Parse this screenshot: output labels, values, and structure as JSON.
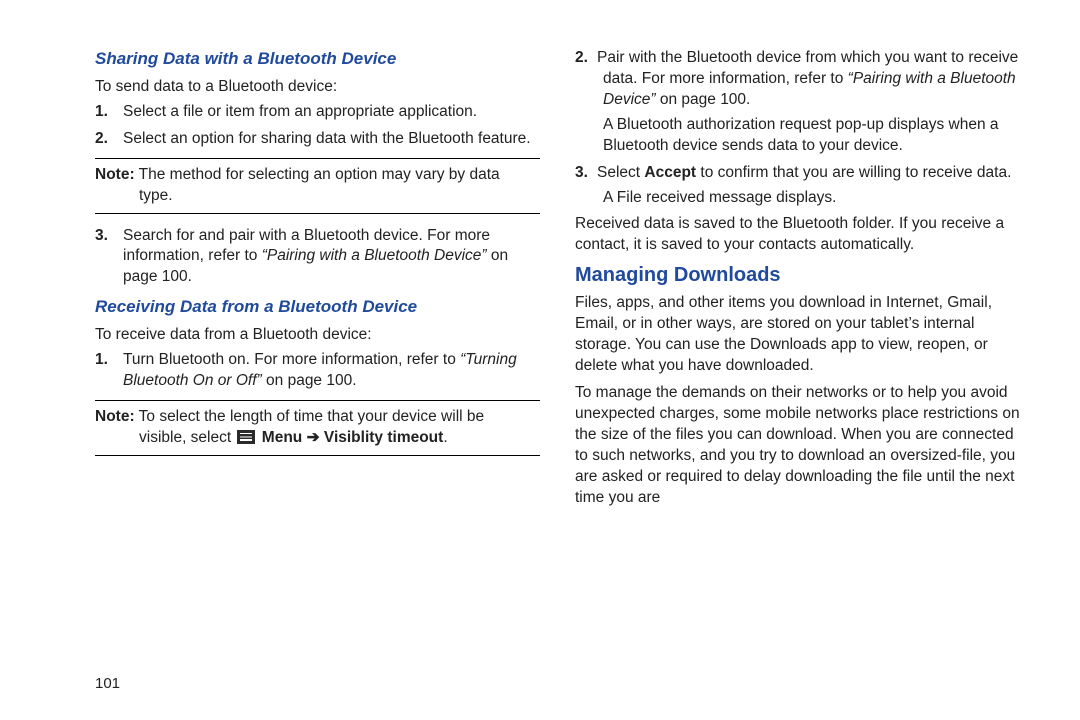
{
  "col1": {
    "h1": "Sharing Data with a Bluetooth Device",
    "intro1": "To send data to a Bluetooth device:",
    "li1_num": "1.",
    "li1": "Select a file or item from an appropriate application.",
    "li2_num": "2.",
    "li2": "Select an option for sharing data with the Bluetooth feature.",
    "note1_label": "Note:",
    "note1_lead": " The method for selecting an option may vary by data",
    "note1_cont": "type.",
    "li3_num": "3.",
    "li3a": "Search for and pair with a Bluetooth device. For more information, refer to ",
    "li3_ref": "“Pairing with a Bluetooth Device”",
    "li3b": " on page 100.",
    "h2": "Receiving Data from a Bluetooth Device",
    "intro2": "To receive data from a Bluetooth device:",
    "r_li1_num": "1.",
    "r_li1a": "Turn Bluetooth on. For more information, refer to ",
    "r_li1_ref": "“Turning Bluetooth On or Off”",
    "r_li1b": " on page 100.",
    "note2_label": "Note:",
    "note2_lead": " To select the length of time that your device will be",
    "note2_cont_a": "visible, select ",
    "note2_menu": " Menu ",
    "note2_arrow": "➔",
    "note2_vt": " Visiblity timeout",
    "note2_period": "."
  },
  "col2": {
    "li2_num": "2.",
    "li2a": "Pair with the Bluetooth device from which you want to receive data. For more information, refer to ",
    "li2_ref": "“Pairing with a Bluetooth Device”",
    "li2b": " on page 100.",
    "li2_p2": "A Bluetooth authorization request pop-up displays when a Bluetooth device sends data to your device.",
    "li3_num": "3.",
    "li3a": "Select ",
    "li3_bold": "Accept",
    "li3b": " to confirm that you are willing to receive data.",
    "li3_p2": "A File received message displays.",
    "para_recv": "Received data is saved to the Bluetooth folder. If you receive a contact, it is saved to your contacts automatically.",
    "h_main": "Managing Downloads",
    "md_p1": "Files, apps, and other items you download in Internet, Gmail, Email, or in other ways, are stored on your tablet’s internal storage. You can use the Downloads app to view, reopen, or delete what you have downloaded.",
    "md_p2": "To manage the demands on their networks or to help you avoid unexpected charges, some mobile networks place restrictions on the size of the files you can download. When you are connected to such networks, and you try to download an oversized-file, you are asked or required to delay downloading the file until the next time you are"
  },
  "page_number": "101"
}
